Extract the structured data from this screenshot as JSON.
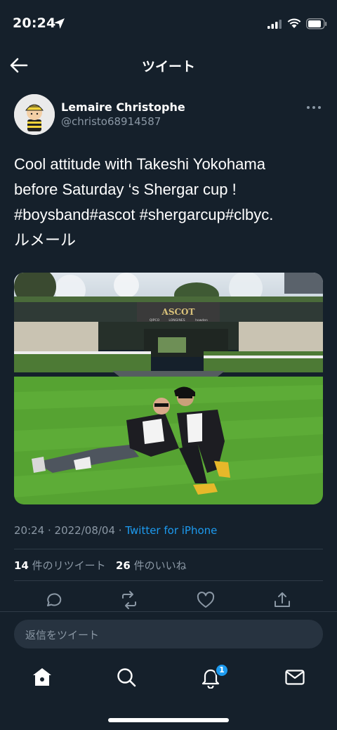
{
  "status_bar": {
    "time": "20:24"
  },
  "nav": {
    "title": "ツイート"
  },
  "tweet": {
    "author_name": "Lemaire Christophe",
    "author_handle": "@christo68914587",
    "text_lines": [
      "Cool attitude with Takeshi Yokohama",
      "before Saturday ‘s Shergar cup !",
      "#boysband#ascot #shergarcup#clbyc.",
      "ルメール"
    ],
    "photo": {
      "sign_main": "ASCOT",
      "sign_sponsors": [
        "QIPCO",
        "LONGINES",
        "howden"
      ]
    },
    "time": "20:24",
    "date": "2022/08/04",
    "source": "Twitter for iPhone",
    "retweet_count": "14",
    "retweet_label": "件のリツイート",
    "like_count": "26",
    "like_label": "件のいいね"
  },
  "reply": {
    "placeholder": "返信をツイート"
  },
  "tab_bar": {
    "notification_badge": "1"
  },
  "colors": {
    "background": "#15202b",
    "accent": "#1d9bf0",
    "muted": "#8b98a5"
  }
}
